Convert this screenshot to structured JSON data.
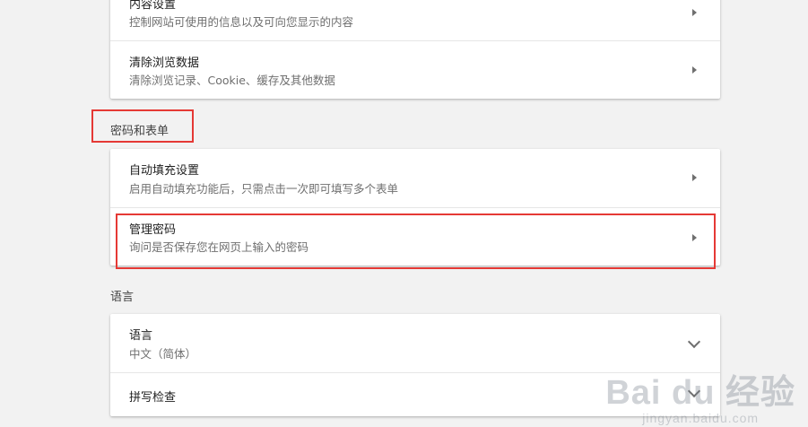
{
  "privacy_card": {
    "content_settings": {
      "title": "内容设置",
      "subtitle": "控制网站可使用的信息以及可向您显示的内容"
    },
    "clear_browsing_data": {
      "title": "清除浏览数据",
      "subtitle": "清除浏览记录、Cookie、缓存及其他数据"
    }
  },
  "passwords_section": {
    "label": "密码和表单",
    "autofill": {
      "title": "自动填充设置",
      "subtitle": "启用自动填充功能后，只需点击一次即可填写多个表单"
    },
    "manage_passwords": {
      "title": "管理密码",
      "subtitle": "询问是否保存您在网页上输入的密码"
    }
  },
  "languages_section": {
    "label": "语言",
    "language": {
      "title": "语言",
      "value": "中文（简体）"
    },
    "spell_check": {
      "title": "拼写检查"
    }
  },
  "watermark": {
    "brand": "Bai du 经验",
    "url": "jingyan.baidu.com"
  },
  "colors": {
    "highlight": "#e53935",
    "background": "#f2f2f2",
    "card": "#ffffff"
  }
}
